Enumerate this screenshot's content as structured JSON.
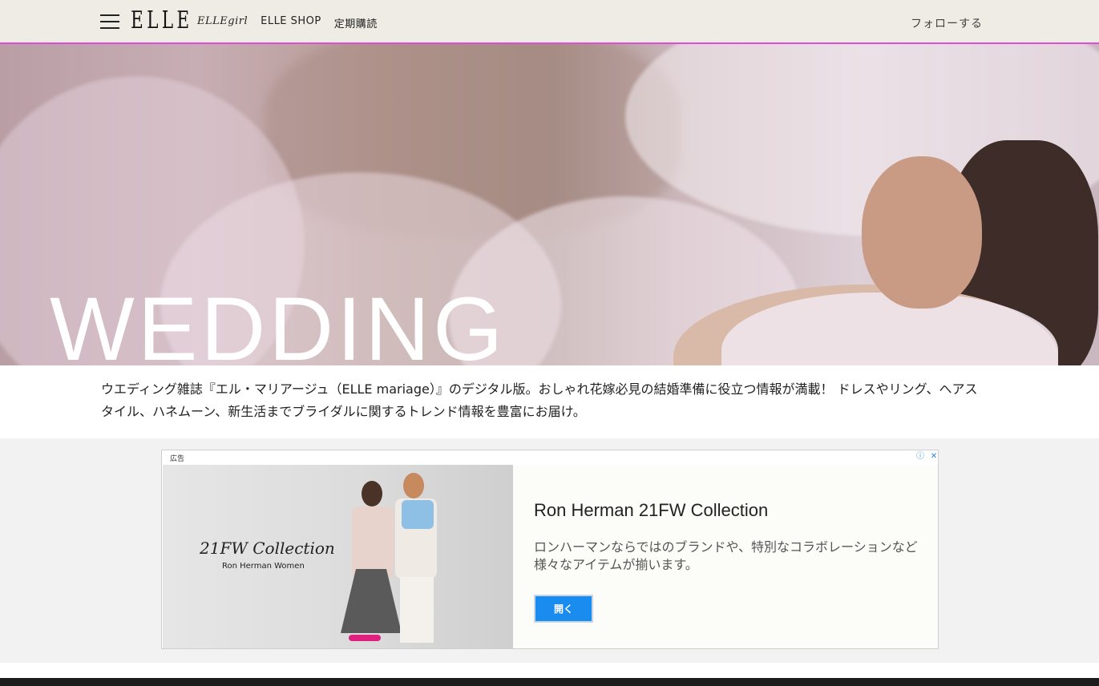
{
  "header": {
    "logo": "ELLE",
    "nav": [
      "ELLEgirl",
      "ELLE SHOP",
      "定期購読"
    ],
    "follow": "フォローする"
  },
  "hero": {
    "title": "WEDDING"
  },
  "description": "ウエディング雑誌『エル・マリアージュ（ELLE mariage）』のデジタル版。おしゃれ花嫁必見の結婚準備に役立つ情報が満載！ ドレスやリング、ヘアスタイル、ハネムーン、新生活までブライダルに関するトレンド情報を豊富にお届け。",
  "ad": {
    "label": "広告",
    "info_icon": "ⓘ",
    "close_icon": "✕",
    "image_title": "21FW Collection",
    "image_subtitle": "Ron Herman Women",
    "title": "Ron Herman 21FW Collection",
    "body": "ロンハーマンならではのブランドや、特別なコラボレーションなど様々なアイテムが揃います。",
    "button": "開く",
    "button_color": "#1a8cf0"
  },
  "colors": {
    "header_bg": "#efebe5",
    "accent_line": "#e24bd6",
    "footer": "#1d1d1d"
  }
}
